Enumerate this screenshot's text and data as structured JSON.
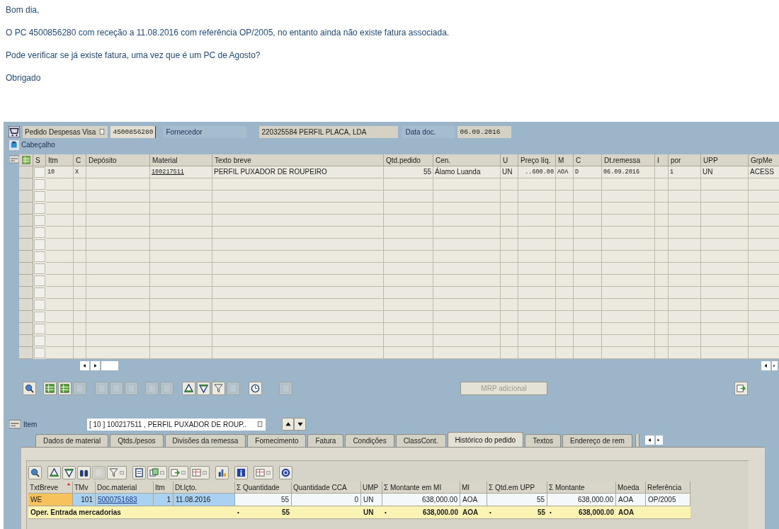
{
  "email": {
    "paragraphs": [
      "Bom dia,",
      "O PC 4500856280 com receção a 11.08.2016 com referência OP/2005, no entanto ainda não existe fatura associada.",
      "Pode verificar se já existe fatura, uma vez que é um PC de Agosto?",
      "Obrigado"
    ]
  },
  "header": {
    "doc_type": "Pedido Despesas Visa",
    "doc_number": "4500856280",
    "supplier_label": "Fornecedor",
    "supplier": "220325584 PERFIL PLACA, LDA",
    "date_label": "Data doc.",
    "date": "06.09.2016"
  },
  "header_section": {
    "label": "Cabeçalho",
    "expanded": false
  },
  "items_table": {
    "columns": [
      "S",
      "Itm",
      "C",
      "Depósito",
      "Material",
      "Texto breve",
      "Qtd.pedido",
      "Cen.",
      "U",
      "Preço líq.",
      "M",
      "C",
      "Dt.remessa",
      "I",
      "por",
      "UPP",
      "GrpMe"
    ],
    "rows": [
      {
        "cells": [
          "",
          "10",
          "X",
          "",
          "100217511",
          "PERFIL PUXADOR DE ROUPEIRO",
          "55",
          "Álamo Luanda",
          "UN",
          "..600.00",
          "AOA",
          "D",
          "06.09.2016",
          "",
          "1",
          "UN",
          "ACESS"
        ]
      }
    ]
  },
  "upper_toolbar": [
    {
      "disabled": false
    },
    {
      "disabled": false
    },
    {
      "disabled": false
    },
    {
      "disabled": true
    },
    {
      "disabled": true
    },
    {
      "disabled": true
    },
    {
      "disabled": true
    },
    {
      "disabled": true
    },
    {
      "disabled": true
    },
    {
      "disabled": false
    },
    {
      "disabled": false
    },
    {
      "disabled": false
    },
    {
      "disabled": true
    },
    {
      "disabled": false
    },
    {
      "disabled": true
    }
  ],
  "mrp_button": {
    "label": "MRP adicional",
    "disabled": true
  },
  "item_selector": {
    "label": "Item",
    "value": "[ 10 ] 100217511 , PERFIL PUXADOR DE ROUP.."
  },
  "tabs": [
    {
      "label": "Dados de material",
      "selected": false
    },
    {
      "label": "Qtds./pesos",
      "selected": false
    },
    {
      "label": "Divisões da remessa",
      "selected": false
    },
    {
      "label": "Fornecimento",
      "selected": false
    },
    {
      "label": "Fatura",
      "selected": false
    },
    {
      "label": "Condições",
      "selected": false
    },
    {
      "label": "ClassCont.",
      "selected": false
    },
    {
      "label": "Histórico do pedido",
      "selected": true
    },
    {
      "label": "Textos",
      "selected": false
    },
    {
      "label": "Endereço de rem",
      "selected": false
    }
  ],
  "history_toolbar": [
    {
      "disabled": false
    },
    {
      "disabled": false
    },
    {
      "disabled": false
    },
    {
      "disabled": false
    },
    {
      "disabled": true
    },
    {
      "disabled": false
    },
    {
      "disabled": false
    },
    {
      "disabled": false
    },
    {
      "disabled": false
    },
    {
      "disabled": false
    },
    {
      "disabled": false
    },
    {
      "disabled": false
    },
    {
      "disabled": false
    },
    {
      "disabled": false
    }
  ],
  "history_table": {
    "columns": [
      {
        "label": "TxtBreve",
        "kind": "text",
        "sorted": true
      },
      {
        "label": "TMv",
        "kind": "key",
        "sorted": false
      },
      {
        "label": "Doc.material",
        "kind": "key",
        "sorted": false
      },
      {
        "label": "Itm",
        "kind": "key",
        "sorted": false
      },
      {
        "label": "Dt.lçto.",
        "kind": "key",
        "sorted": false
      },
      {
        "label": "Σ Quantidade",
        "kind": "value",
        "sorted": false
      },
      {
        "label": "Quantidade CCA",
        "kind": "value",
        "sorted": false
      },
      {
        "label": "UMP",
        "kind": "value",
        "sorted": false
      },
      {
        "label": "Σ Montante em MI",
        "kind": "value",
        "sorted": false
      },
      {
        "label": "MI",
        "kind": "value",
        "sorted": false
      },
      {
        "label": "Σ Qtd.em UPP",
        "kind": "value",
        "sorted": false
      },
      {
        "label": "Σ Montante",
        "kind": "value",
        "sorted": false
      },
      {
        "label": "Moeda",
        "kind": "value",
        "sorted": false
      },
      {
        "label": "Referência",
        "kind": "value",
        "sorted": false
      }
    ],
    "rows": [
      {
        "cells": [
          "WE",
          "101",
          "5000751683",
          "1",
          "11.08.2016",
          "55",
          "0",
          "UN",
          "638,000.00",
          "AOA",
          "55",
          "638,000.00",
          "AOA",
          "OP/2005"
        ]
      }
    ],
    "total_row": {
      "label": "Oper. Entrada mercadorias",
      "cells": [
        {
          "marker": "•",
          "text": "55"
        },
        {},
        {
          "text": "UN"
        },
        {
          "marker": "•",
          "text": "638,000.00"
        },
        {
          "text": "AOA"
        },
        {
          "marker": "•",
          "text": "55"
        },
        {
          "marker": "•",
          "text": "638,000.00"
        },
        {
          "text": "AOA"
        },
        {}
      ]
    }
  }
}
